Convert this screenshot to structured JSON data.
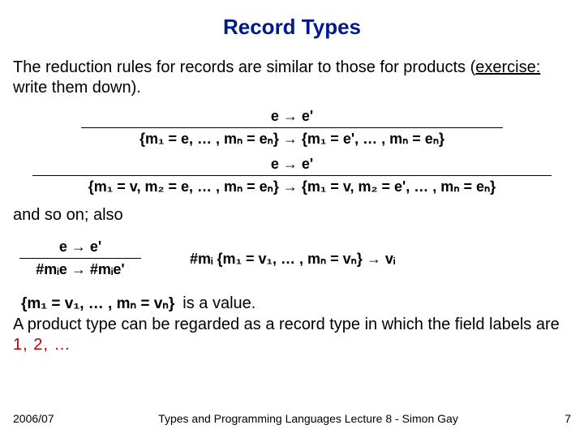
{
  "title": "Record Types",
  "para1_a": "The reduction rules for records are similar to those for products (",
  "para1_b": "exercise:",
  "para1_c": " write them down).",
  "rule1": {
    "top": "e → e'",
    "bot": "{m₁ = e, …  , mₙ = eₙ} → {m₁ = e', …  , mₙ = eₙ}"
  },
  "rule2": {
    "top": "e → e'",
    "bot": "{m₁ = v, m₂ = e, …  , mₙ = eₙ} → {m₁ = v, m₂ = e', …  , mₙ = eₙ}"
  },
  "para2": "and so on; also",
  "rule3": {
    "top": "e → e'",
    "bot": "#mᵢe → #mᵢe'"
  },
  "rule4": "#mᵢ {m₁ = v₁, …  , mₙ = vₙ} → vᵢ",
  "value_expr": "{m₁ = v₁, …  , mₙ = vₙ}",
  "value_txt": " is a value.",
  "para3_a": "A product type can be regarded as a record type in which the field labels are ",
  "para3_b": "1, 2, …",
  "footer": {
    "left": "2006/07",
    "center": "Types and Programming Languages Lecture 8 - Simon Gay",
    "right": "7"
  }
}
